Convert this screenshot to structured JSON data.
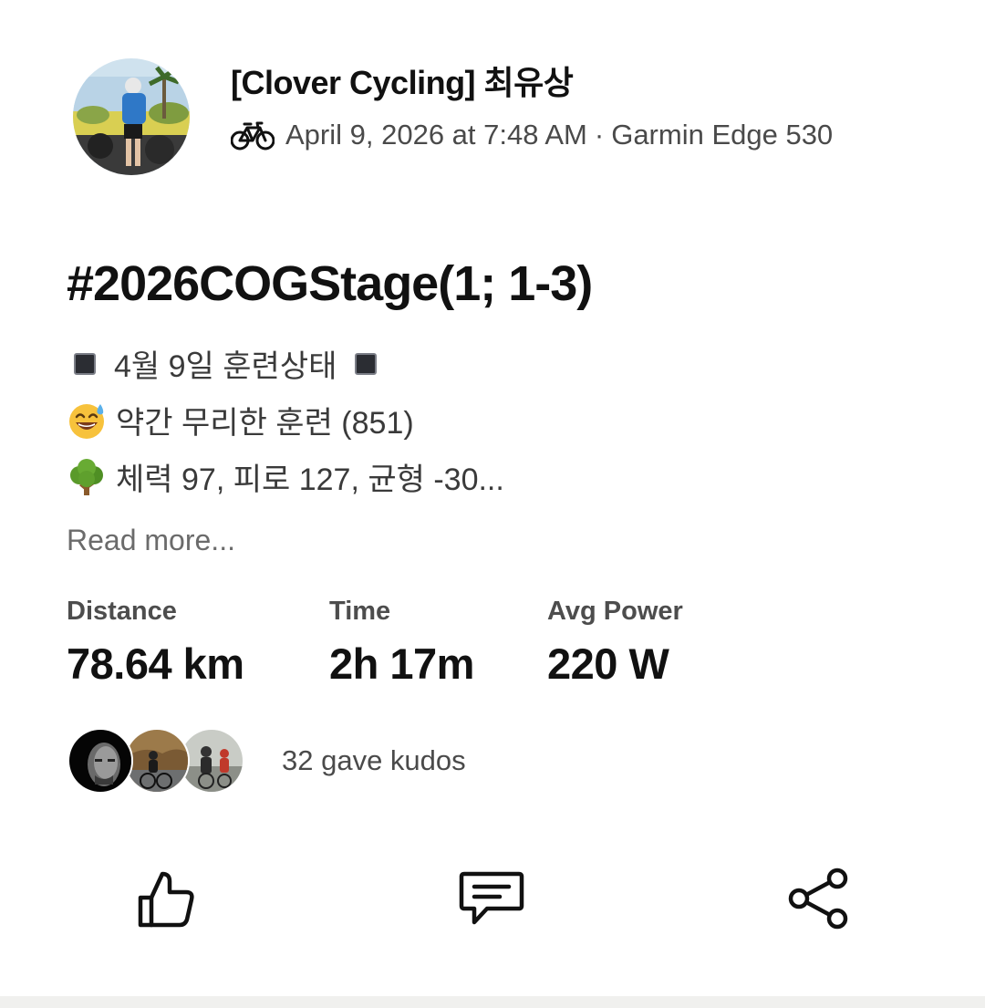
{
  "athlete": {
    "name": "[Clover Cycling] 최유상",
    "avatar": "athlete-avatar"
  },
  "meta": {
    "sport_icon": "bike-icon",
    "date": "April 9, 2026 at 7:48 AM",
    "separator": "·",
    "device": "Garmin Edge 530"
  },
  "activity": {
    "title": "#2026COGStage(1; 1-3)",
    "description": {
      "line1": "4월 9일 훈련상태",
      "line2": "약간 무리한 훈련 (851)",
      "line3": "체력 97, 피로 127, 균형 -30..."
    },
    "read_more": "Read more..."
  },
  "stats": [
    {
      "label": "Distance",
      "value": "78.64 km"
    },
    {
      "label": "Time",
      "value": "2h 17m"
    },
    {
      "label": "Avg Power",
      "value": "220 W"
    }
  ],
  "kudos": {
    "text": "32 gave kudos",
    "avatars": [
      "kudo-avatar-1",
      "kudo-avatar-2",
      "kudo-avatar-3"
    ]
  },
  "actions": {
    "kudos_icon": "thumbs-up-icon",
    "comment_icon": "comment-icon",
    "share_icon": "share-icon"
  },
  "colors": {
    "text_primary": "#111111",
    "text_secondary": "#4a4a4a",
    "footer_band": "#f0f0ee"
  }
}
